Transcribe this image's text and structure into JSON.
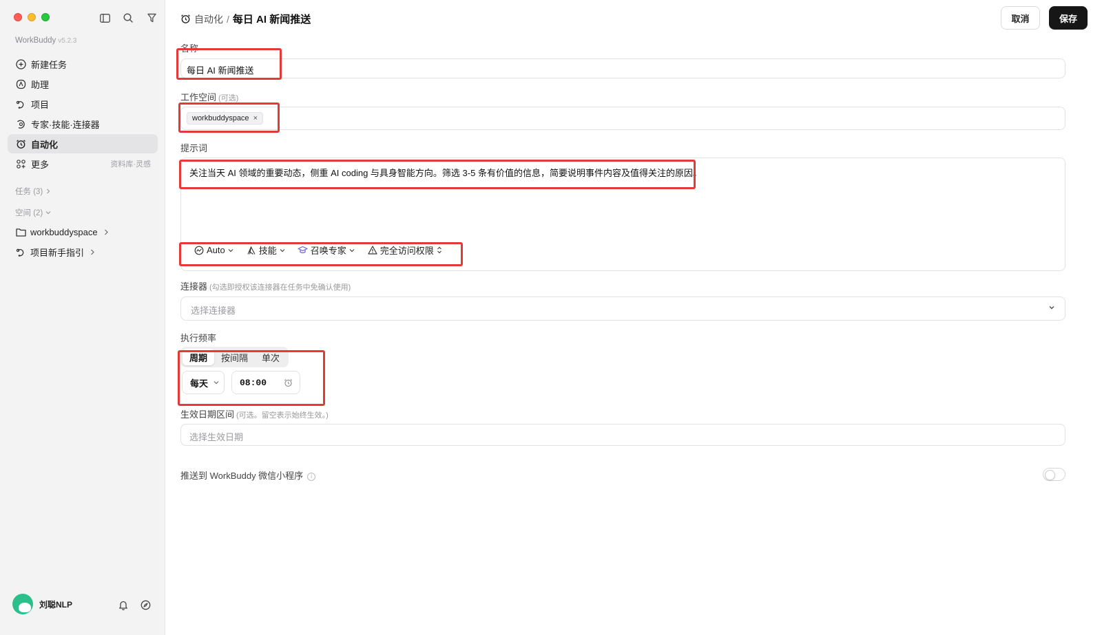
{
  "app": {
    "name": "WorkBuddy",
    "version": "v5.2.3"
  },
  "sidebar": {
    "items": [
      {
        "label": "新建任务",
        "icon": "plus-circle-icon"
      },
      {
        "label": "助理",
        "icon": "assistant-icon"
      },
      {
        "label": "项目",
        "icon": "project-icon"
      },
      {
        "label": "专家·技能·连接器",
        "icon": "expert-icon"
      },
      {
        "label": "自动化",
        "icon": "alarm-icon",
        "active": true
      },
      {
        "label": "更多",
        "icon": "grid-icon",
        "hint": "资料库·灵感"
      }
    ],
    "tasks_header": "任务 (3)",
    "spaces_header": "空间 (2)",
    "spaces": [
      {
        "label": "workbuddyspace",
        "icon": "folder-icon"
      },
      {
        "label": "项目新手指引",
        "icon": "project-icon"
      }
    ],
    "user": {
      "name": "刘聪NLP"
    }
  },
  "header": {
    "breadcrumb_parent": "自动化",
    "separator": "/",
    "title": "每日 AI 新闻推送",
    "cancel_label": "取消",
    "save_label": "保存"
  },
  "form": {
    "name": {
      "label": "名称",
      "value": "每日 AI 新闻推送"
    },
    "workspace": {
      "label": "工作空间",
      "optional": "(可选)",
      "chip": "workbuddyspace",
      "remove": "×"
    },
    "prompt": {
      "label": "提示词",
      "value": "关注当天 AI 领域的重要动态，侧重 AI coding 与具身智能方向。筛选 3-5 条有价值的信息，简要说明事件内容及值得关注的原因。",
      "toolbar": {
        "model": "Auto",
        "skills": "技能",
        "expert": "召唤专家",
        "access": "完全访问权限"
      }
    },
    "connector": {
      "label": "连接器",
      "note": "(勾选即授权该连接器在任务中免确认使用)",
      "placeholder": "选择连接器"
    },
    "frequency": {
      "label": "执行频率",
      "tabs": [
        "周期",
        "按间隔",
        "单次"
      ],
      "active_tab": "周期",
      "period": "每天",
      "time": "08:00"
    },
    "date_range": {
      "label": "生效日期区间",
      "note": "(可选。留空表示始终生效。)",
      "placeholder": "选择生效日期"
    },
    "push": {
      "label": "推送到 WorkBuddy 微信小程序",
      "enabled": false
    }
  },
  "colors": {
    "highlight": "#e53935",
    "save_button": "#161616",
    "sidebar_bg": "#f3f3f4"
  }
}
